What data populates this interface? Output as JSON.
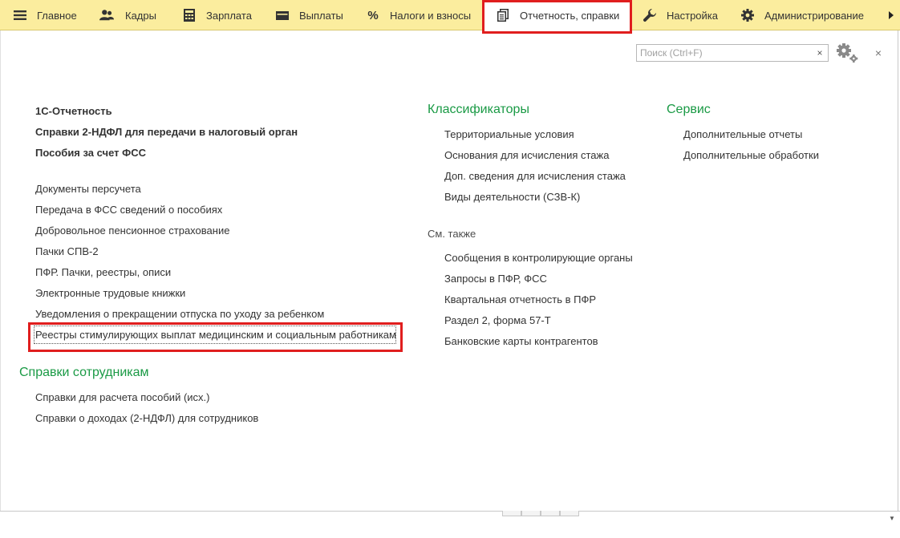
{
  "nav": {
    "tabs": [
      {
        "label": "Главное",
        "icon": "menu-icon"
      },
      {
        "label": "Кадры",
        "icon": "people-icon"
      },
      {
        "label": "Зарплата",
        "icon": "calculator-icon"
      },
      {
        "label": "Выплаты",
        "icon": "wallet-icon"
      },
      {
        "label": "Налоги и взносы",
        "icon": "percent-icon"
      },
      {
        "label": "Отчетность, справки",
        "icon": "documents-icon",
        "active": true
      },
      {
        "label": "Настройка",
        "icon": "wrench-icon"
      },
      {
        "label": "Администрирование",
        "icon": "gear-icon"
      }
    ],
    "more_icon": "triangle-right-icon"
  },
  "search": {
    "placeholder": "Поиск (Ctrl+F)",
    "value": "",
    "clear_label": "×"
  },
  "close_label": "×",
  "left": {
    "bold_links": [
      "1С-Отчетность",
      "Справки 2-НДФЛ для передачи в налоговый орган",
      "Пособия за счет ФСС"
    ],
    "links": [
      "Документы персучета",
      "Передача в ФСС сведений о пособиях",
      "Добровольное пенсионное страхование",
      "Пачки СПВ-2",
      "ПФР. Пачки, реестры, описи",
      "Электронные трудовые книжки",
      "Уведомления о прекращении отпуска по уходу за ребенком",
      "Реестры стимулирующих выплат медицинским и социальным работникам"
    ],
    "group2": {
      "title": "Справки сотрудникам",
      "links": [
        "Справки для расчета пособий (исх.)",
        "Справки о доходах (2-НДФЛ) для сотрудников"
      ]
    }
  },
  "middle": {
    "title": "Классификаторы",
    "links": [
      "Территориальные условия",
      "Основания для исчисления стажа",
      "Доп. сведения для исчисления стажа",
      "Виды деятельности (СЗВ-К)"
    ],
    "see_also": {
      "title": "См. также",
      "links": [
        "Сообщения в контролирующие органы",
        "Запросы в ПФР, ФСС",
        "Квартальная отчетность в ПФР",
        "Раздел 2, форма 57-Т",
        "Банковские карты контрагентов"
      ]
    }
  },
  "right": {
    "title": "Сервис",
    "links": [
      "Дополнительные отчеты",
      "Дополнительные обработки"
    ]
  },
  "colors": {
    "topbar": "#fbed9e",
    "group_title": "#1a9a45",
    "highlight": "#e01e1e",
    "text": "#333333"
  }
}
